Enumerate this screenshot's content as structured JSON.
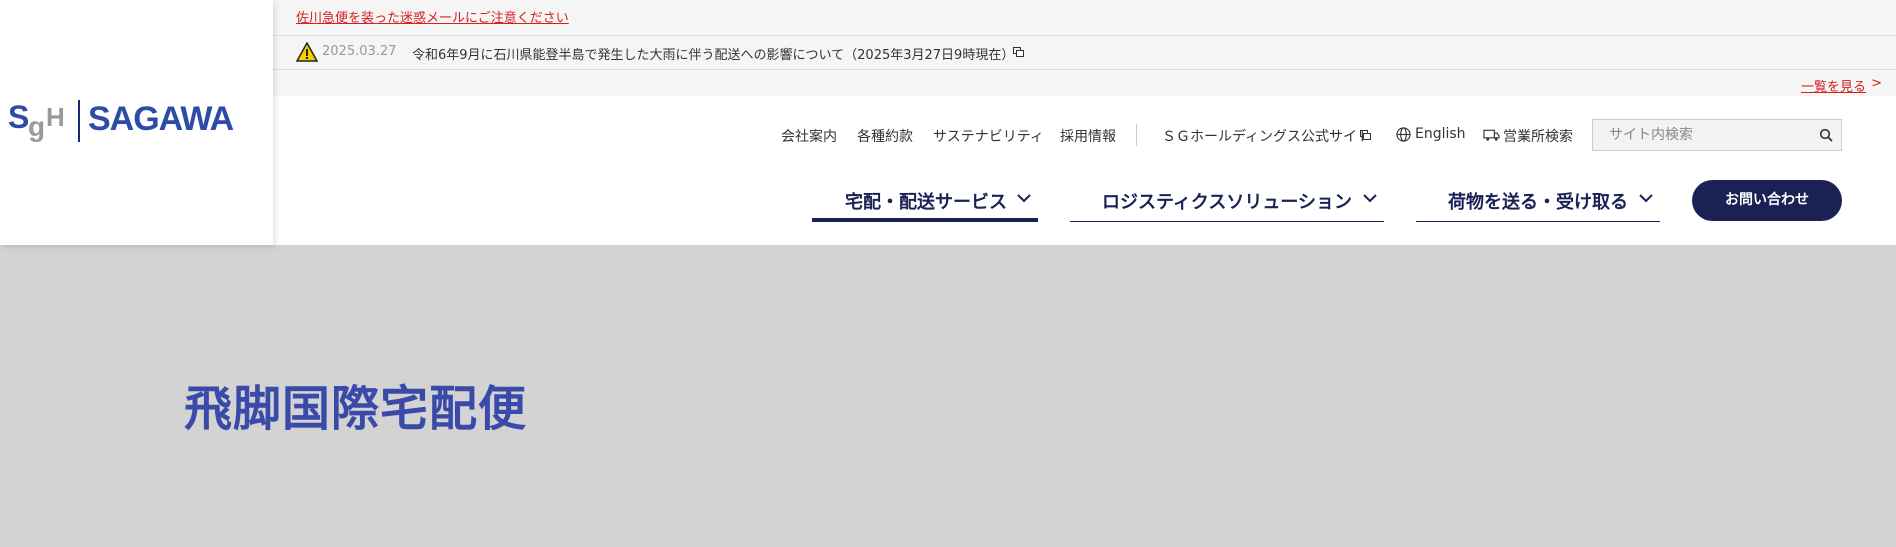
{
  "notices": {
    "scam_warning": "佐川急便を装った迷惑メールにご注意ください",
    "date": "2025.03.27",
    "text": "令和6年9月に石川県能登半島で発生した大雨に伴う配送への影響について（2025年3月27日9時現在）",
    "view_all": "一覧を見る"
  },
  "logo": {
    "mark": "SgH",
    "text": "SAGAWA"
  },
  "util_nav": [
    {
      "label": "会社案内"
    },
    {
      "label": "各種約款"
    },
    {
      "label": "サステナビリティ"
    },
    {
      "label": "採用情報"
    },
    {
      "label": "ＳＧホールディングス公式サイト"
    },
    {
      "label": "English"
    },
    {
      "label": "営業所検索"
    }
  ],
  "search": {
    "placeholder": "サイト内検索"
  },
  "main_nav": [
    {
      "label": "宅配・配送サービス",
      "active": true
    },
    {
      "label": "ロジスティクスソリューション",
      "active": false
    },
    {
      "label": "荷物を送る・受け取る",
      "active": false
    }
  ],
  "contact_button": "お問い合わせ",
  "hero": {
    "title": "飛脚国際宅配便"
  },
  "colors": {
    "navy": "#1b2155",
    "brand_blue": "#2d4ca6",
    "alert_red": "#d4201f",
    "hero_bg": "#d3d3d3"
  }
}
